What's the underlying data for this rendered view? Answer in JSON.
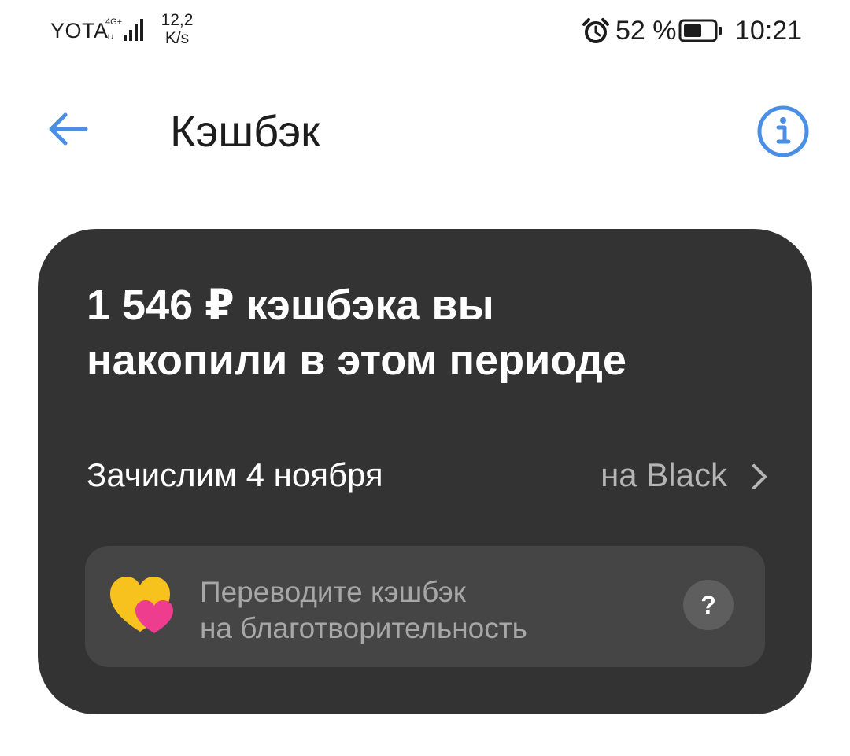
{
  "status_bar": {
    "carrier": "YOTA",
    "network_type": "4G+",
    "net_speed_value": "12,2",
    "net_speed_unit": "K/s",
    "battery_percent": "52 %",
    "time": "10:21",
    "icons": [
      "signal-icon",
      "alarm-icon",
      "battery-icon"
    ]
  },
  "header": {
    "title": "Кэшбэк",
    "back_icon": "arrow-left-icon",
    "info_icon": "info-icon",
    "accent_color": "#4a8ee6"
  },
  "cashback_card": {
    "headline_line1": "1 546 ₽ кэшбэка вы",
    "headline_line2": "накопили в этом периоде",
    "accrual_date": "Зачислим 4 ноября",
    "accrual_target": "на Black",
    "charity": {
      "line1": "Переводите кэшбэк",
      "line2": "на благотворительность",
      "help_label": "?",
      "icon": "hearts-icon"
    },
    "card_color": "#333333"
  }
}
